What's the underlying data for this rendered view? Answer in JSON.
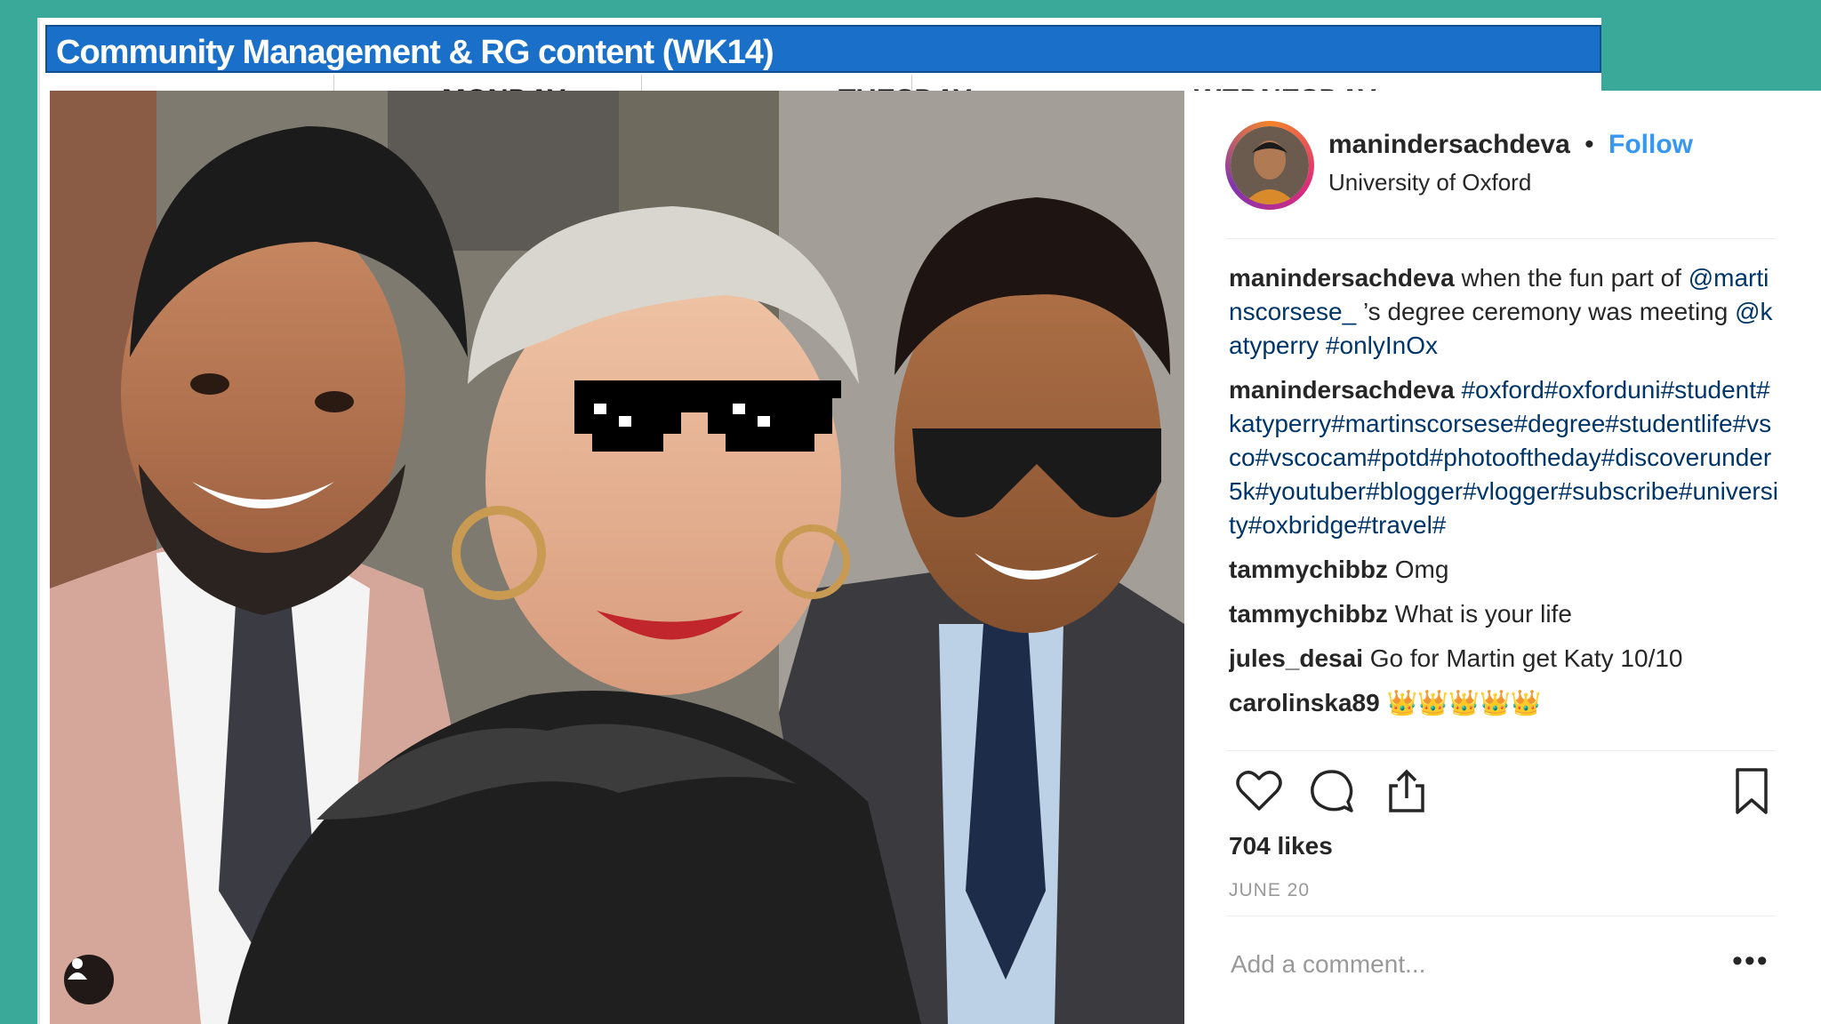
{
  "sheet": {
    "title": "Community Management & RG content (WK14)",
    "days": [
      "MONDAY",
      "TUESDAY",
      "WEDNESDAY"
    ]
  },
  "post": {
    "username": "manindersachdeva",
    "separator": "•",
    "follow_label": "Follow",
    "location": "University of Oxford",
    "comments": [
      {
        "user": "manindersachdeva",
        "segments": [
          {
            "t": " when the fun part of ",
            "link": false
          },
          {
            "t": "@martinscorsese_",
            "link": true
          },
          {
            "t": " ’s degree ceremony was meeting ",
            "link": false
          },
          {
            "t": "@katyperry",
            "link": true
          },
          {
            "t": " ",
            "link": false
          },
          {
            "t": "#onlyInOx",
            "link": true
          }
        ]
      },
      {
        "user": "manindersachdeva",
        "segments": [
          {
            "t": " #oxford#oxforduni#student#katyperry#martinscorsese#degree#studentlife#vsco#vscocam#potd#photooftheday#discoverunder5k#youtuber#blogger#vlogger#subscribe#university#oxbridge#travel#",
            "link": true
          }
        ]
      },
      {
        "user": "tammychibbz",
        "segments": [
          {
            "t": " Omg",
            "link": false
          }
        ]
      },
      {
        "user": "tammychibbz",
        "segments": [
          {
            "t": " What is your life",
            "link": false
          }
        ]
      },
      {
        "user": "jules_desai",
        "segments": [
          {
            "t": " Go for Martin get Katy 10/10",
            "link": false
          }
        ]
      },
      {
        "user": "carolinska89",
        "segments": [
          {
            "t": " 👑👑👑👑👑",
            "link": false
          }
        ]
      }
    ],
    "likes": "704 likes",
    "date": "JUNE 20",
    "comment_placeholder": "Add a comment...",
    "more_label": "•••",
    "icons": [
      "heart-icon",
      "comment-icon",
      "share-icon",
      "bookmark-icon",
      "user-tag-icon"
    ]
  },
  "colors": {
    "background": "#3aa99a",
    "header_blue": "#1a6fc8",
    "link": "#003569",
    "follow": "#3897f0"
  }
}
